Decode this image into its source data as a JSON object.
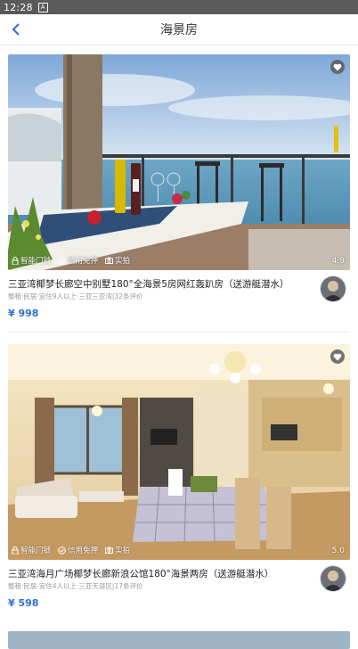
{
  "status_bar": {
    "time": "12:28",
    "notification_icon": "A"
  },
  "header": {
    "title": "海景房",
    "back_icon": "chevron-left-icon"
  },
  "listings": [
    {
      "title": "三亚湾椰梦长廊空中别墅180°全海景5房网红轰趴房（送游艇潜水）",
      "subtitle": "整租·民居·宜住9人以上·三亚三亚湾|32条评价",
      "price": "¥ 998",
      "rating": "4.9",
      "tags": [
        "智能门锁",
        "信用免押",
        "实拍"
      ]
    },
    {
      "title": "三亚湾海月广场椰梦长廊新浪公馆180°海景两房（送游艇潜水）",
      "subtitle": "整租·民居·宜住4人以上·三亚天涯区|17条评价",
      "price": "¥ 598",
      "rating": "5.0",
      "tags": [
        "智能门锁",
        "信用免押",
        "实拍"
      ]
    }
  ],
  "colors": {
    "accent": "#2a6fd6",
    "status_bar": "#5a5a5a"
  }
}
